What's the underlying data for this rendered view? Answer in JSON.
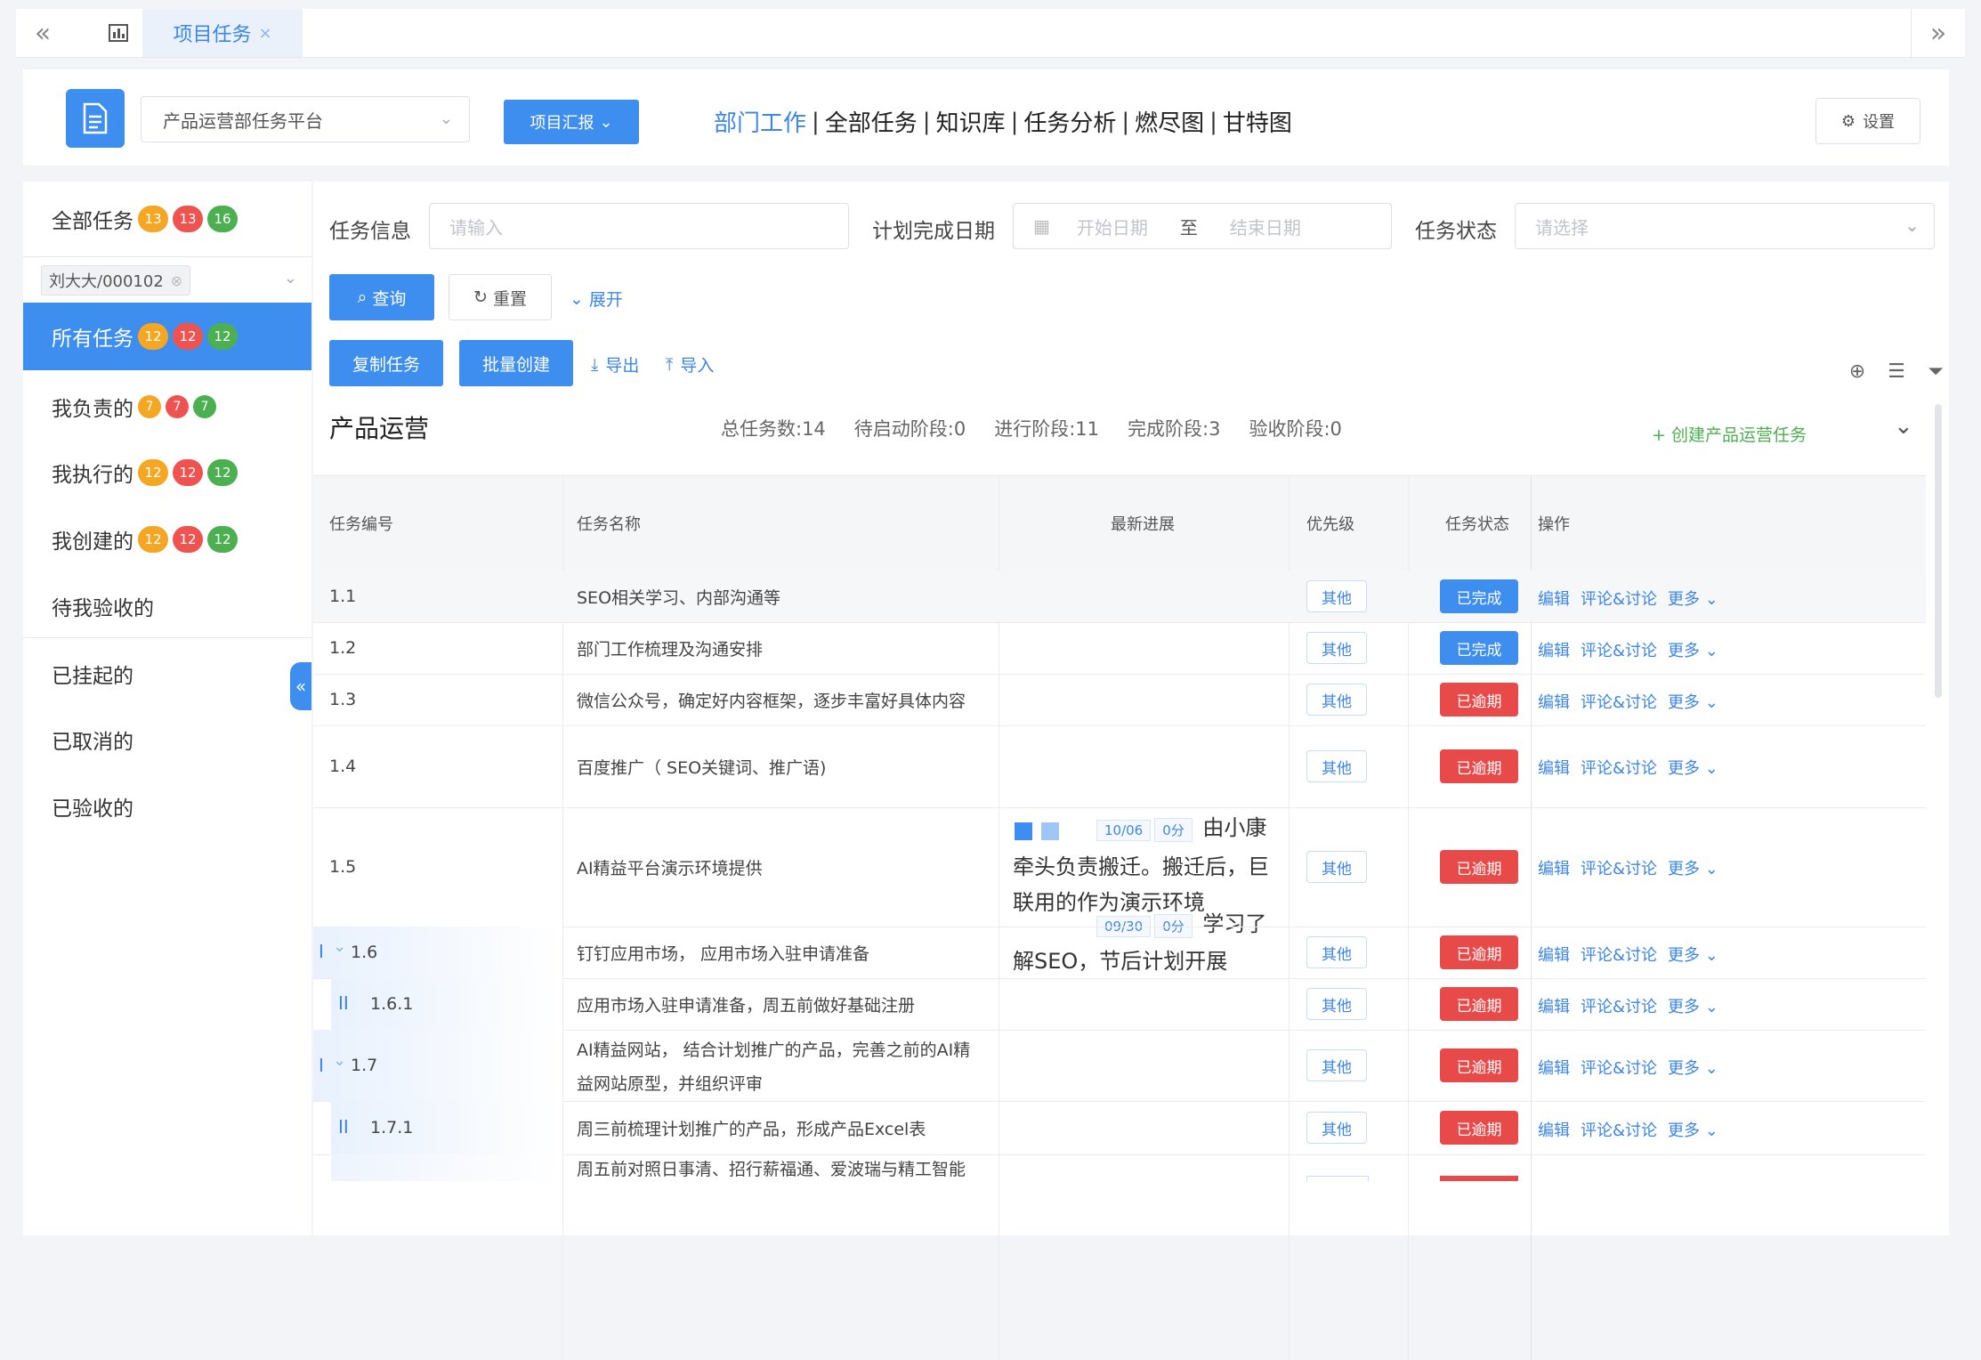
{
  "tabbar": {
    "tab_label": "项目任务",
    "close": "×",
    "nav_left": "«",
    "nav_right": "»"
  },
  "header": {
    "platform": "产品运营部任务平台",
    "report_button": "项目汇报",
    "nav": [
      "部门工作",
      "全部任务",
      "知识库",
      "任务分析",
      "燃尽图",
      "甘特图"
    ],
    "nav_separator": "|",
    "settings": "设置"
  },
  "sidebar": {
    "all_tasks": {
      "label": "全部任务",
      "badges": [
        "13",
        "13",
        "16"
      ]
    },
    "user": "刘大大/000102",
    "items": [
      {
        "label": "所有任务",
        "badges": [
          "12",
          "12",
          "12"
        ]
      },
      {
        "label": "我负责的",
        "badges": [
          "7",
          "7",
          "7"
        ]
      },
      {
        "label": "我执行的",
        "badges": [
          "12",
          "12",
          "12"
        ]
      },
      {
        "label": "我创建的",
        "badges": [
          "12",
          "12",
          "12"
        ]
      },
      {
        "label": "待我验收的"
      },
      {
        "label": "已挂起的"
      },
      {
        "label": "已取消的"
      },
      {
        "label": "已验收的"
      }
    ]
  },
  "filters": {
    "task_info_label": "任务信息",
    "task_info_placeholder": "请输入",
    "plan_date_label": "计划完成日期",
    "start_placeholder": "开始日期",
    "to": "至",
    "end_placeholder": "结束日期",
    "status_label": "任务状态",
    "status_placeholder": "请选择",
    "query": "查询",
    "reset": "重置",
    "expand": "展开",
    "copy_task": "复制任务",
    "batch_create": "批量创建",
    "export": "导出",
    "import": "导入"
  },
  "section": {
    "title": "产品运营",
    "stats": [
      "总任务数:14",
      "待启动阶段:0",
      "进行阶段:11",
      "完成阶段:3",
      "验收阶段:0"
    ],
    "create": "+ 创建产品运营任务"
  },
  "table": {
    "headers": [
      "任务编号",
      "任务名称",
      "最新进展",
      "优先级",
      "任务状态",
      "操作"
    ],
    "ops": [
      "编辑",
      "评论&讨论",
      "更多 ⌄"
    ],
    "rows": [
      {
        "id": "1.1",
        "name": "SEO相关学习、内部沟通等",
        "priority": "其他",
        "status": "已完成"
      },
      {
        "id": "1.2",
        "name": "部门工作梳理及沟通安排",
        "priority": "其他",
        "status": "已完成"
      },
      {
        "id": "1.3",
        "name": "微信公众号，确定好内容框架，逐步丰富好具体内容",
        "priority": "其他",
        "status": "已逾期"
      },
      {
        "id": "1.4",
        "name": "百度推广（ SEO关键词、推广语)",
        "priority": "其他",
        "status": "已逾期"
      },
      {
        "id": "1.5",
        "name": "AI精益平台演示环境提供",
        "priority": "其他",
        "status": "已逾期"
      },
      {
        "id": "1.6",
        "level": "I",
        "name": "钉钉应用市场， 应用市场入驻申请准备",
        "priority": "其他",
        "status": "已逾期"
      },
      {
        "id": "1.6.1",
        "level": "II",
        "name": "应用市场入驻申请准备，周五前做好基础注册",
        "priority": "其他",
        "status": "已逾期"
      },
      {
        "id": "1.7",
        "level": "I",
        "name_line1": "AI精益网站， 结合计划推广的产品，完善之前的AI精",
        "name_line2": "益网站原型，并组织评审",
        "priority": "其他",
        "status": "已逾期"
      },
      {
        "id": "1.7.1",
        "level": "II",
        "name": "周三前梳理计划推广的产品，形成产品Excel表",
        "priority": "其他",
        "status": "已逾期"
      },
      {
        "name": "周五前对照日事清、招行薪福通、爱波瑞与精工智能"
      }
    ],
    "progress": {
      "p1_date": "09/30",
      "p1_score": "0分",
      "p1_line1": "学习了",
      "p1_line2": "解SEO，节后计划开展",
      "p2_date": "10/06",
      "p2_score": "0分",
      "p2_line1": "由小康",
      "p2_line2": "牵头负责搬迁。搬迁后，巨",
      "p2_line3": "联用的作为演示环境"
    }
  }
}
